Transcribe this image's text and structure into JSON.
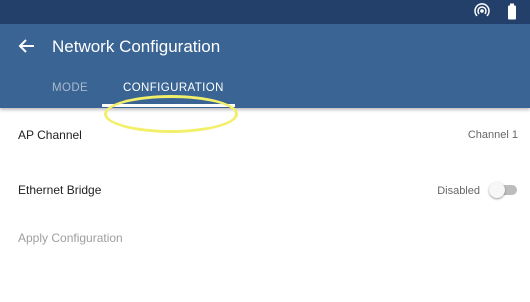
{
  "status_bar": {
    "icons": [
      "hotspot-icon",
      "battery-icon"
    ]
  },
  "header": {
    "title": "Network Configuration",
    "back_icon": "arrow-left-icon"
  },
  "tabs": [
    {
      "label": "MODE",
      "selected": false
    },
    {
      "label": "CONFIGURATION",
      "selected": true
    }
  ],
  "settings": {
    "ap_channel": {
      "label": "AP Channel",
      "value": "Channel 1"
    },
    "ethernet_bridge": {
      "label": "Ethernet Bridge",
      "value": "Disabled",
      "enabled": false
    },
    "apply": {
      "label": "Apply Configuration",
      "enabled": false
    }
  },
  "colors": {
    "status_bar": "#22406a",
    "app_bar": "#3a6493",
    "highlight": "#f2ef6a",
    "disabled_text": "#9e9e9e"
  }
}
